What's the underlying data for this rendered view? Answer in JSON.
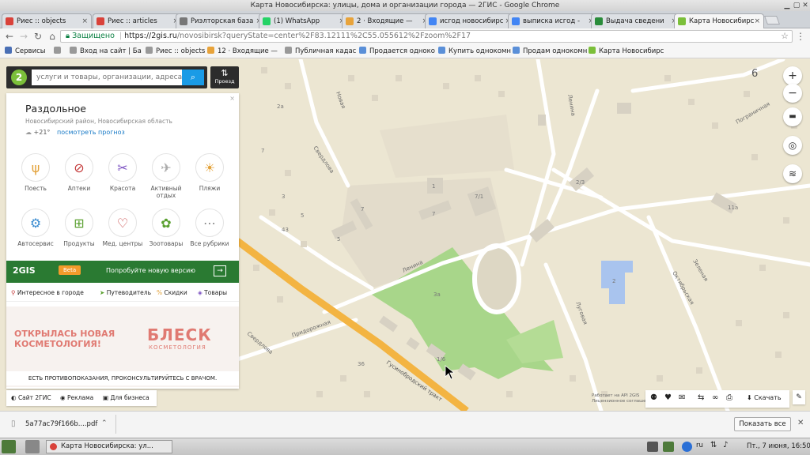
{
  "window": {
    "title": "Карта Новосибирска: улицы, дома и организации города — 2ГИС - Google Chrome"
  },
  "tabs": [
    {
      "label": "Риес :: objects",
      "color": "#d9423a"
    },
    {
      "label": "Риес :: articles",
      "color": "#d9423a"
    },
    {
      "label": "Риэлторская база",
      "color": "#777777"
    },
    {
      "label": "(1) WhatsApp",
      "color": "#25d366"
    },
    {
      "label": "2 · Входящие — ",
      "color": "#e8a33a"
    },
    {
      "label": "исгод новосибирс",
      "color": "#4285f4"
    },
    {
      "label": "выписка исгод -",
      "color": "#4285f4"
    },
    {
      "label": "Выдача сведени",
      "color": "#2a8c3a"
    },
    {
      "label": "Карта Новосибирс",
      "color": "#7bbf3a"
    }
  ],
  "address": {
    "secure_label": "Защищено",
    "host": "https://2gis.ru",
    "path": "/novosibirsk?queryState=center%2F83.12111%2C55.055612%2Fzoom%2F17"
  },
  "bookmarks": [
    {
      "label": "Сервисы",
      "color": "#4a6fb5"
    },
    {
      "label": "",
      "color": "#999999"
    },
    {
      "label": "Вход на сайт | Ба",
      "color": "#999999"
    },
    {
      "label": "Риес :: objects",
      "color": "#999999"
    },
    {
      "label": "12 · Входящие —",
      "color": "#e8a33a"
    },
    {
      "label": "Публичная кадас",
      "color": "#999999"
    },
    {
      "label": "Продается одноко",
      "color": "#5a8fd8"
    },
    {
      "label": "Купить однокомн",
      "color": "#5a8fd8"
    },
    {
      "label": "Продам однокомн",
      "color": "#5a8fd8"
    },
    {
      "label": "Карта Новосибирс",
      "color": "#7bbf3a"
    }
  ],
  "search": {
    "placeholder": "услуги и товары, организации, адреса",
    "route_label": "Проезд"
  },
  "place": {
    "name": "Раздольное",
    "region": "Новосибирский район, Новосибирская область",
    "temp": "+21°",
    "forecast": "посмотреть прогноз"
  },
  "categories": [
    {
      "label": "Поесть",
      "icon": "fork-icon",
      "glyph": "ψ"
    },
    {
      "label": "Аптеки",
      "icon": "pill-icon",
      "glyph": "⊘"
    },
    {
      "label": "Красота",
      "icon": "scissors-icon",
      "glyph": "✂"
    },
    {
      "label": "Активный отдых",
      "icon": "plane-icon",
      "glyph": "✈"
    },
    {
      "label": "Пляжи",
      "icon": "sun-icon",
      "glyph": "☀"
    },
    {
      "label": "Автосервис",
      "icon": "engine-icon",
      "glyph": "⚙"
    },
    {
      "label": "Продукты",
      "icon": "basket-icon",
      "glyph": "⊞"
    },
    {
      "label": "Мед. центры",
      "icon": "stethoscope-icon",
      "glyph": "♡"
    },
    {
      "label": "Зоотовары",
      "icon": "paw-icon",
      "glyph": "✿"
    },
    {
      "label": "Все рубрики",
      "icon": "dots-icon",
      "glyph": "⋯"
    }
  ],
  "promo": {
    "brand": "2GIS",
    "badge": "Beta",
    "text": "Попробуйте новую версию"
  },
  "panel_nav": [
    {
      "label": "Интересное в городе"
    },
    {
      "label": "Путеводитель"
    },
    {
      "label": "Скидки"
    },
    {
      "label": "Товары"
    }
  ],
  "ad": {
    "headline1": "ОТКРЫЛАСЬ НОВАЯ",
    "headline2": "КОСМЕТОЛОГИЯ!",
    "brand": "БЛЕСК",
    "brand_sub": "КОСМЕТОЛОГИЯ",
    "disclaimer": "ЕСТЬ ПРОТИВОПОКАЗАНИЯ, ПРОКОНСУЛЬТИРУЙТЕСЬ С ВРАЧОМ."
  },
  "footer_links": [
    {
      "label": "Сайт 2ГИС"
    },
    {
      "label": "Реклама"
    },
    {
      "label": "Для бизнеса"
    }
  ],
  "map": {
    "zoom": "6",
    "streets": [
      "Новая",
      "Свердлова",
      "Ленина",
      "Пограничная",
      "Октябрьская",
      "Зеленая",
      "Ленина",
      "Придорожная",
      "Свердлова",
      "Гусинобродский тракт",
      "Луговая"
    ],
    "house_numbers": [
      "2",
      "7",
      "7/1",
      "5",
      "1",
      "2/3",
      "11а",
      "1/6",
      "3а",
      "7",
      "3",
      "43",
      "7",
      "5",
      "2а",
      "36"
    ],
    "attribution": "Работает на API 2GIS\nЛицензионное соглашение",
    "download_label": "Скачать"
  },
  "download": {
    "file": "5a77ac79f166b....pdf",
    "show_all": "Показать все"
  },
  "taskbar": {
    "window": "Карта Новосибирска: ул...",
    "lang": "ru",
    "clock": "Пт., 7 июня, 16:50"
  }
}
